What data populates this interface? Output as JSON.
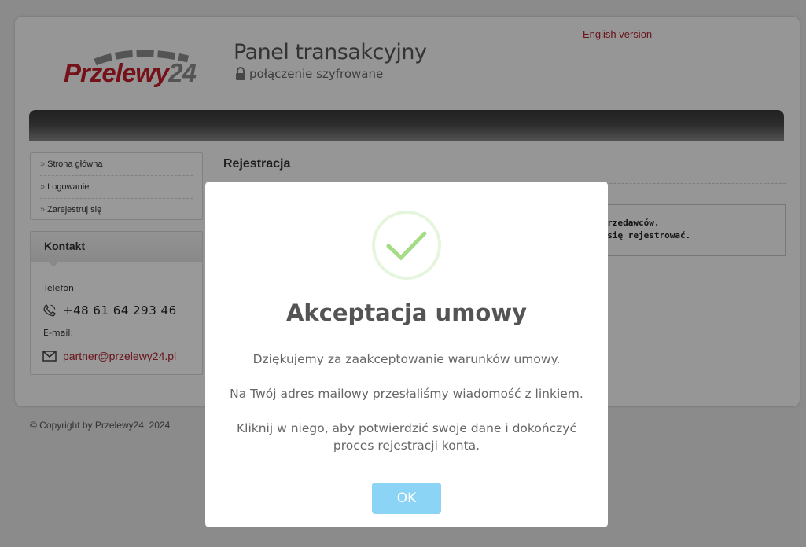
{
  "header": {
    "logo_text_main": "Przelewy",
    "logo_text_num": "24",
    "panel_title": "Panel transakcyjny",
    "secure_text": "połączenie szyfrowane",
    "english_link": "English version",
    "secure_icon": "lock-icon"
  },
  "menu": {
    "items": [
      {
        "label": "Strona główna"
      },
      {
        "label": "Logowanie"
      },
      {
        "label": "Zarejestruj się"
      }
    ]
  },
  "contact": {
    "heading": "Kontakt",
    "phone_label": "Telefon",
    "phone": "+48 61 64 293 46",
    "email_label": "E-mail:",
    "email": "partner@przelewy24.pl",
    "phone_icon": "phone-icon",
    "email_icon": "envelope-icon"
  },
  "main": {
    "section_title": "Rejestracja",
    "info_line1": "sprzedawców.",
    "info_line2": ": się rejestrować."
  },
  "footer": {
    "copyright": "© Copyright by Przelewy24, 2024"
  },
  "modal": {
    "title": "Akceptacja umowy",
    "text1": "Dziękujemy za zaakceptowanie warunków umowy.",
    "text2": "Na Twój adres mailowy przesłaliśmy wiadomość z linkiem.",
    "text3": "Kliknij w niego, aby potwierdzić swoje dane i dokończyć proces rejestracji konta.",
    "ok_label": "OK",
    "success_icon": "checkmark-icon"
  },
  "colors": {
    "brand_red": "#c41e2b",
    "ok_button": "#8cd4f5",
    "success_green": "#a5dc86"
  }
}
